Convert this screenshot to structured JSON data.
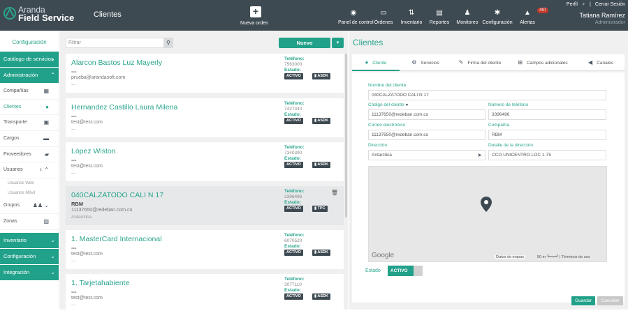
{
  "header": {
    "logo_top": "Aranda",
    "logo_bottom": "Field Service",
    "app_title": "Clientes",
    "new_order": "Nueva orden",
    "nav": [
      {
        "label": "Panel de control",
        "icon": "dashboard-icon"
      },
      {
        "label": "Órdenes",
        "icon": "orders-icon"
      },
      {
        "label": "Inventario",
        "icon": "inventory-icon"
      },
      {
        "label": "Reportes",
        "icon": "reports-icon"
      },
      {
        "label": "Monitoreo",
        "icon": "monitoring-icon"
      },
      {
        "label": "Configuración",
        "icon": "gear-icon"
      },
      {
        "label": "Alertas",
        "icon": "bell-icon"
      }
    ],
    "alerts_count": "497",
    "profile": "Perfil",
    "logout": "Cerrar Sesión",
    "user_name": "Tatiana Ramírez",
    "user_role": "Administrador"
  },
  "sidebar": {
    "title": "Configuración",
    "cat_services": "Catálogo de servicios",
    "cat_admin": "Administración",
    "items": [
      "Compañías",
      "Clientes",
      "Transporte",
      "Cargos",
      "Proveedores",
      "Usuarios"
    ],
    "sub_items": [
      "Usuarios Web",
      "Usuarios Móvil"
    ],
    "items2": [
      "Grupos",
      "Zonas"
    ],
    "cat_inventory": "Inventario",
    "cat_config": "Configuración",
    "cat_integration": "Integración"
  },
  "list": {
    "filter_placeholder": "Filtrar",
    "new_button": "Nuevo",
    "tel_label": "Teléfono:",
    "status_label": "Estado:",
    "cards": [
      {
        "name": "Alarcon Bastos Luz Mayerly",
        "company": "---",
        "email": "prueba@arandasoft.com",
        "address": "---",
        "phone": "7563000",
        "status": "ACTIVO",
        "tag": "ASDK"
      },
      {
        "name": "Hernandez Castillo Laura Milena",
        "company": "---",
        "email": "test@test.com",
        "address": "---",
        "phone": "7427340",
        "status": "ACTIVO",
        "tag": "ASDK"
      },
      {
        "name": "López Wiston",
        "company": "---",
        "email": "test@test.com",
        "address": "---",
        "phone": "7340390",
        "status": "ACTIVO",
        "tag": "ASDK"
      },
      {
        "name": "040CALZATODO CALI N 17",
        "company": "RBM",
        "email": "11137650@redeban.com.co",
        "address": "Antarctica",
        "phone": "3396496",
        "status": "ACTIVO",
        "tag": "TPC"
      },
      {
        "name": "1. MasterCard Internacional",
        "company": "---",
        "email": "test@test.com",
        "address": "---",
        "phone": "6070520",
        "status": "ACTIVO",
        "tag": "ASDK"
      },
      {
        "name": "1. Tarjetahabiente",
        "company": "---",
        "email": "test@test.com",
        "address": "---",
        "phone": "3077110",
        "status": "ACTIVO",
        "tag": "ASDK"
      }
    ]
  },
  "detail": {
    "title": "Clientes",
    "tabs": [
      "Cliente",
      "Servicios",
      "Firma del cliente",
      "Campos adicionales",
      "Canales"
    ],
    "labels": {
      "name": "Nombre del cliente",
      "code": "Código del cliente",
      "phone": "Número de teléfono",
      "email": "Correo electrónico",
      "company": "Compañía",
      "address": "Dirección",
      "address_detail": "Detalle de la dirección",
      "status": "Estado"
    },
    "values": {
      "name": "040CALZATODO CALI N 17",
      "code": "11137650@redeban.com.co",
      "phone": "3396496",
      "email": "11137650@redeban.com.co",
      "company": "RBM",
      "address": "Antarctica",
      "address_detail": "CCO UNICENTRO LOC 1-75"
    },
    "map": {
      "google": "Google",
      "data": "Datos de mapas",
      "scale": "50 m",
      "terms": "Términos de uso"
    },
    "status_value": "ACTIVO",
    "save": "Guardar",
    "cancel": "Cancelar"
  },
  "colors": {
    "accent": "#22a18a",
    "header": "#3e4a52",
    "badge": "#c0392b"
  }
}
